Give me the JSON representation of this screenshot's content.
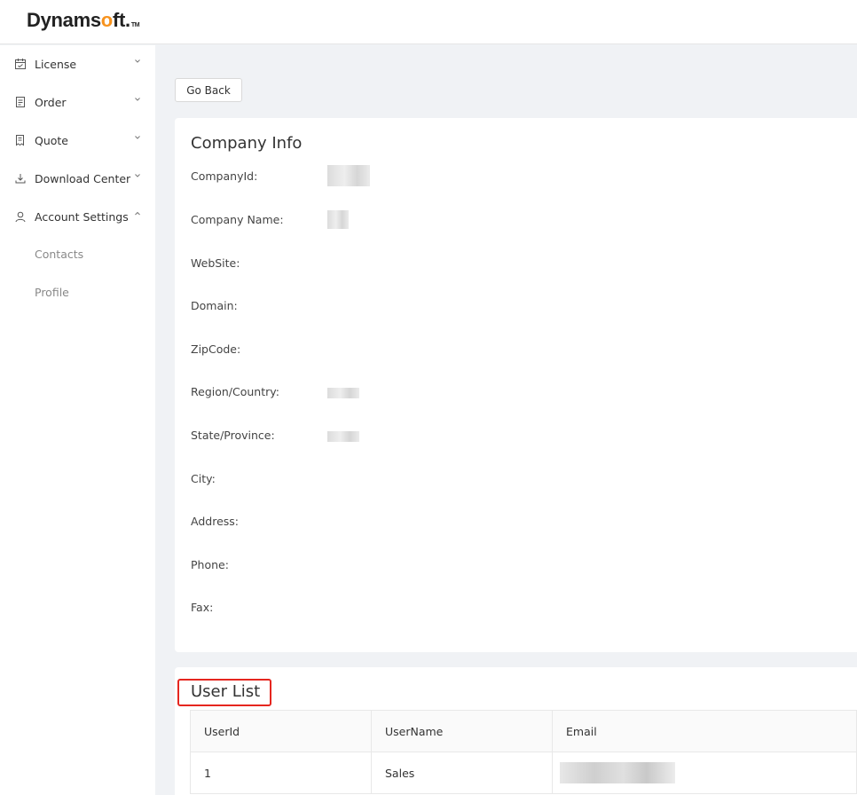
{
  "logo": {
    "prefix": "Dynams",
    "o": "o",
    "suffix": "ft.",
    "tm": "TM"
  },
  "sidebar": {
    "items": [
      {
        "label": "License",
        "icon": "calendar-icon",
        "expanded": false
      },
      {
        "label": "Order",
        "icon": "document-icon",
        "expanded": false
      },
      {
        "label": "Quote",
        "icon": "receipt-icon",
        "expanded": false
      },
      {
        "label": "Download Center",
        "icon": "download-icon",
        "expanded": false
      },
      {
        "label": "Account Settings",
        "icon": "user-icon",
        "expanded": true
      }
    ],
    "subitems": [
      {
        "label": "Contacts"
      },
      {
        "label": "Profile"
      }
    ]
  },
  "toolbar": {
    "go_back": "Go Back"
  },
  "company_info": {
    "title": "Company Info",
    "fields": [
      {
        "label": "CompanyId:",
        "redacted": true
      },
      {
        "label": "Company Name:",
        "redacted": true
      },
      {
        "label": "WebSite:",
        "redacted": false
      },
      {
        "label": "Domain:",
        "redacted": false
      },
      {
        "label": "ZipCode:",
        "redacted": false
      },
      {
        "label": "Region/Country:",
        "redacted": true
      },
      {
        "label": "State/Province:",
        "redacted": true
      },
      {
        "label": "City:",
        "redacted": false
      },
      {
        "label": "Address:",
        "redacted": false
      },
      {
        "label": "Phone:",
        "redacted": false
      },
      {
        "label": "Fax:",
        "redacted": false
      }
    ]
  },
  "user_list": {
    "title": "User List",
    "columns": [
      "UserId",
      "UserName",
      "Email"
    ],
    "rows": [
      {
        "userid": "1",
        "username": "Sales",
        "email_redacted": true
      }
    ]
  },
  "colors": {
    "highlight": "#e5261f",
    "logo_accent": "#f7931e",
    "background": "#f0f2f5"
  }
}
